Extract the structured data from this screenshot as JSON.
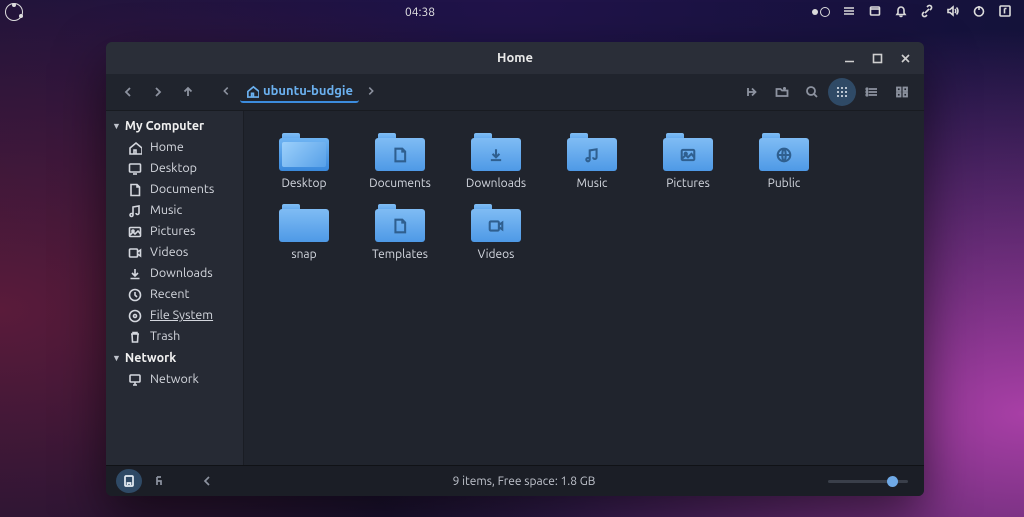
{
  "panel": {
    "clock": "04:38"
  },
  "window": {
    "title": "Home",
    "breadcrumb": {
      "segment": "ubuntu-budgie"
    },
    "status": "9 items, Free space: 1.8 GB"
  },
  "sidebar": {
    "section1": "My Computer",
    "section2": "Network",
    "items1": [
      {
        "icon": "home",
        "label": "Home"
      },
      {
        "icon": "desktop",
        "label": "Desktop"
      },
      {
        "icon": "doc",
        "label": "Documents"
      },
      {
        "icon": "music",
        "label": "Music"
      },
      {
        "icon": "pictures",
        "label": "Pictures"
      },
      {
        "icon": "video",
        "label": "Videos"
      },
      {
        "icon": "download",
        "label": "Downloads"
      },
      {
        "icon": "recent",
        "label": "Recent"
      },
      {
        "icon": "disk",
        "label": "File System",
        "sel": true
      },
      {
        "icon": "trash",
        "label": "Trash"
      }
    ],
    "items2": [
      {
        "icon": "network",
        "label": "Network"
      }
    ]
  },
  "folders": [
    {
      "label": "Desktop",
      "glyph": "desk"
    },
    {
      "label": "Documents",
      "glyph": "doc"
    },
    {
      "label": "Downloads",
      "glyph": "download"
    },
    {
      "label": "Music",
      "glyph": "music"
    },
    {
      "label": "Pictures",
      "glyph": "pictures"
    },
    {
      "label": "Public",
      "glyph": "public"
    },
    {
      "label": "snap",
      "glyph": ""
    },
    {
      "label": "Templates",
      "glyph": "doc"
    },
    {
      "label": "Videos",
      "glyph": "video"
    }
  ]
}
